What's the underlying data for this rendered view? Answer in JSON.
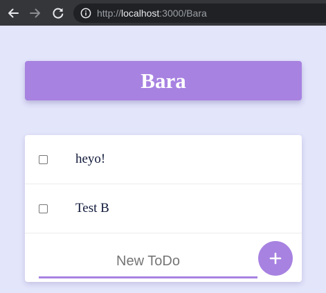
{
  "browser": {
    "url_prefix": "http://",
    "url_host": "localhost",
    "url_rest": ":3000/Bara",
    "icons": {
      "back": "arrow-left-icon",
      "forward": "arrow-right-icon",
      "reload": "reload-icon",
      "site_info": "info-icon"
    }
  },
  "page": {
    "title": "Bara"
  },
  "todos": [
    {
      "text": "heyo!",
      "checked": false
    },
    {
      "text": "Test B",
      "checked": false
    }
  ],
  "new_todo": {
    "placeholder": "New ToDo",
    "value": ""
  },
  "add_button": {
    "icon": "plus-icon"
  },
  "colors": {
    "accent": "#a782e1",
    "background": "#e3e5fb",
    "card": "#ffffff",
    "toolbar": "#35363a"
  }
}
